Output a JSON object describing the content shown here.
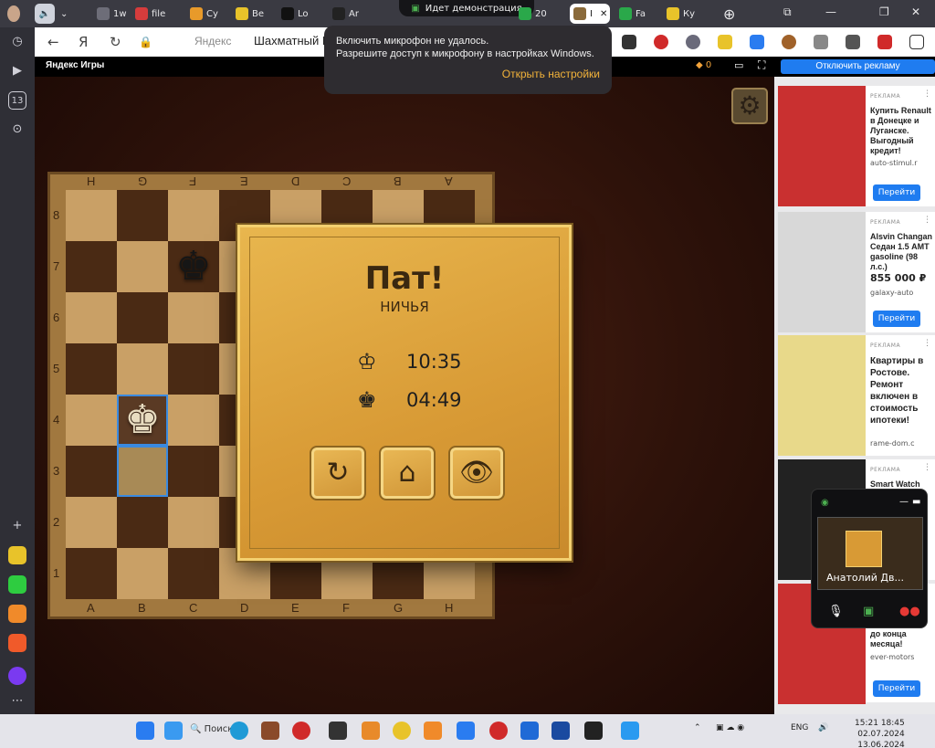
{
  "tabs": [
    {
      "label": "1w",
      "color": "#6d6d78"
    },
    {
      "label": "file",
      "color": "#d63c3c"
    },
    {
      "label": "Су",
      "color": "#e89a2a"
    },
    {
      "label": "Be",
      "color": "#e8c32a"
    },
    {
      "label": "Lo",
      "color": "#111111"
    },
    {
      "label": "Ar",
      "color": "#222222"
    },
    {
      "label": "20",
      "color": "#2aa84a"
    },
    {
      "label": "I",
      "color": "#8a6a3a"
    },
    {
      "label": "Fa",
      "color": "#2aa84a"
    },
    {
      "label": "Ку",
      "color": "#e8c32a"
    }
  ],
  "demo_banner": "Идет демонстрация",
  "address": {
    "domain": "Яндекс",
    "page_title": "Шахматный Мастер"
  },
  "toast": {
    "line1": "Включить микрофон не удалось.",
    "line2": "Разрешите доступ к микрофону в настройках Windows.",
    "action": "Открыть настройки"
  },
  "yandex_games": {
    "title": "Яндекс Игры",
    "coins": "0",
    "disable_ads": "Отключить рекламу"
  },
  "board": {
    "files": [
      "A",
      "B",
      "C",
      "D",
      "E",
      "F",
      "G",
      "H"
    ],
    "files_top": [
      "H",
      "G",
      "F",
      "E",
      "D",
      "C",
      "B",
      "A"
    ],
    "ranks": [
      "8",
      "7",
      "6",
      "5",
      "4",
      "3",
      "2",
      "1"
    ],
    "black_king": "c7",
    "white_king": "b4",
    "highlighted": [
      "b4",
      "b3"
    ]
  },
  "dialog": {
    "title": "Пат!",
    "subtitle": "НИЧЬЯ",
    "white_time": "10:35",
    "black_time": "04:49"
  },
  "ads": [
    {
      "label": "РЕКЛАМА",
      "text": "Купить Renault в Донецке и Луганске. Выгодный кредит!",
      "domain": "auto-stimul.r",
      "button": "Перейти",
      "image_color": "#c93030"
    },
    {
      "label": "РЕКЛАМА",
      "text": "Alsvin Changan Седан 1.5 AMT gasoline (98 л.с.)",
      "price": "855 000 ₽",
      "domain": "galaxy-auto",
      "button": "Перейти",
      "image_color": "#d8d8d8"
    },
    {
      "label": "РЕКЛАМА",
      "text": "Квартиры в Ростове. Ремонт включен в стоимость ипотеки!",
      "domain": "rame-dom.c",
      "button": "",
      "image_color": "#e8d98a"
    },
    {
      "label": "РЕКЛАМА",
      "text": "Smart Watch",
      "domain": "",
      "button": "",
      "image_color": "#222222"
    },
    {
      "label": "РЕКЛАМА",
      "text": "до конца месяца!",
      "domain": "ever-motors",
      "button": "Перейти",
      "image_color": "#c93030"
    }
  ],
  "call": {
    "name": "Анатолий Дв..."
  },
  "taskbar": {
    "search": "Поиск",
    "lang": "ENG",
    "time1": "15:21",
    "date1": "02.07.2024",
    "time2": "18:45",
    "date2": "13.06.2024"
  }
}
